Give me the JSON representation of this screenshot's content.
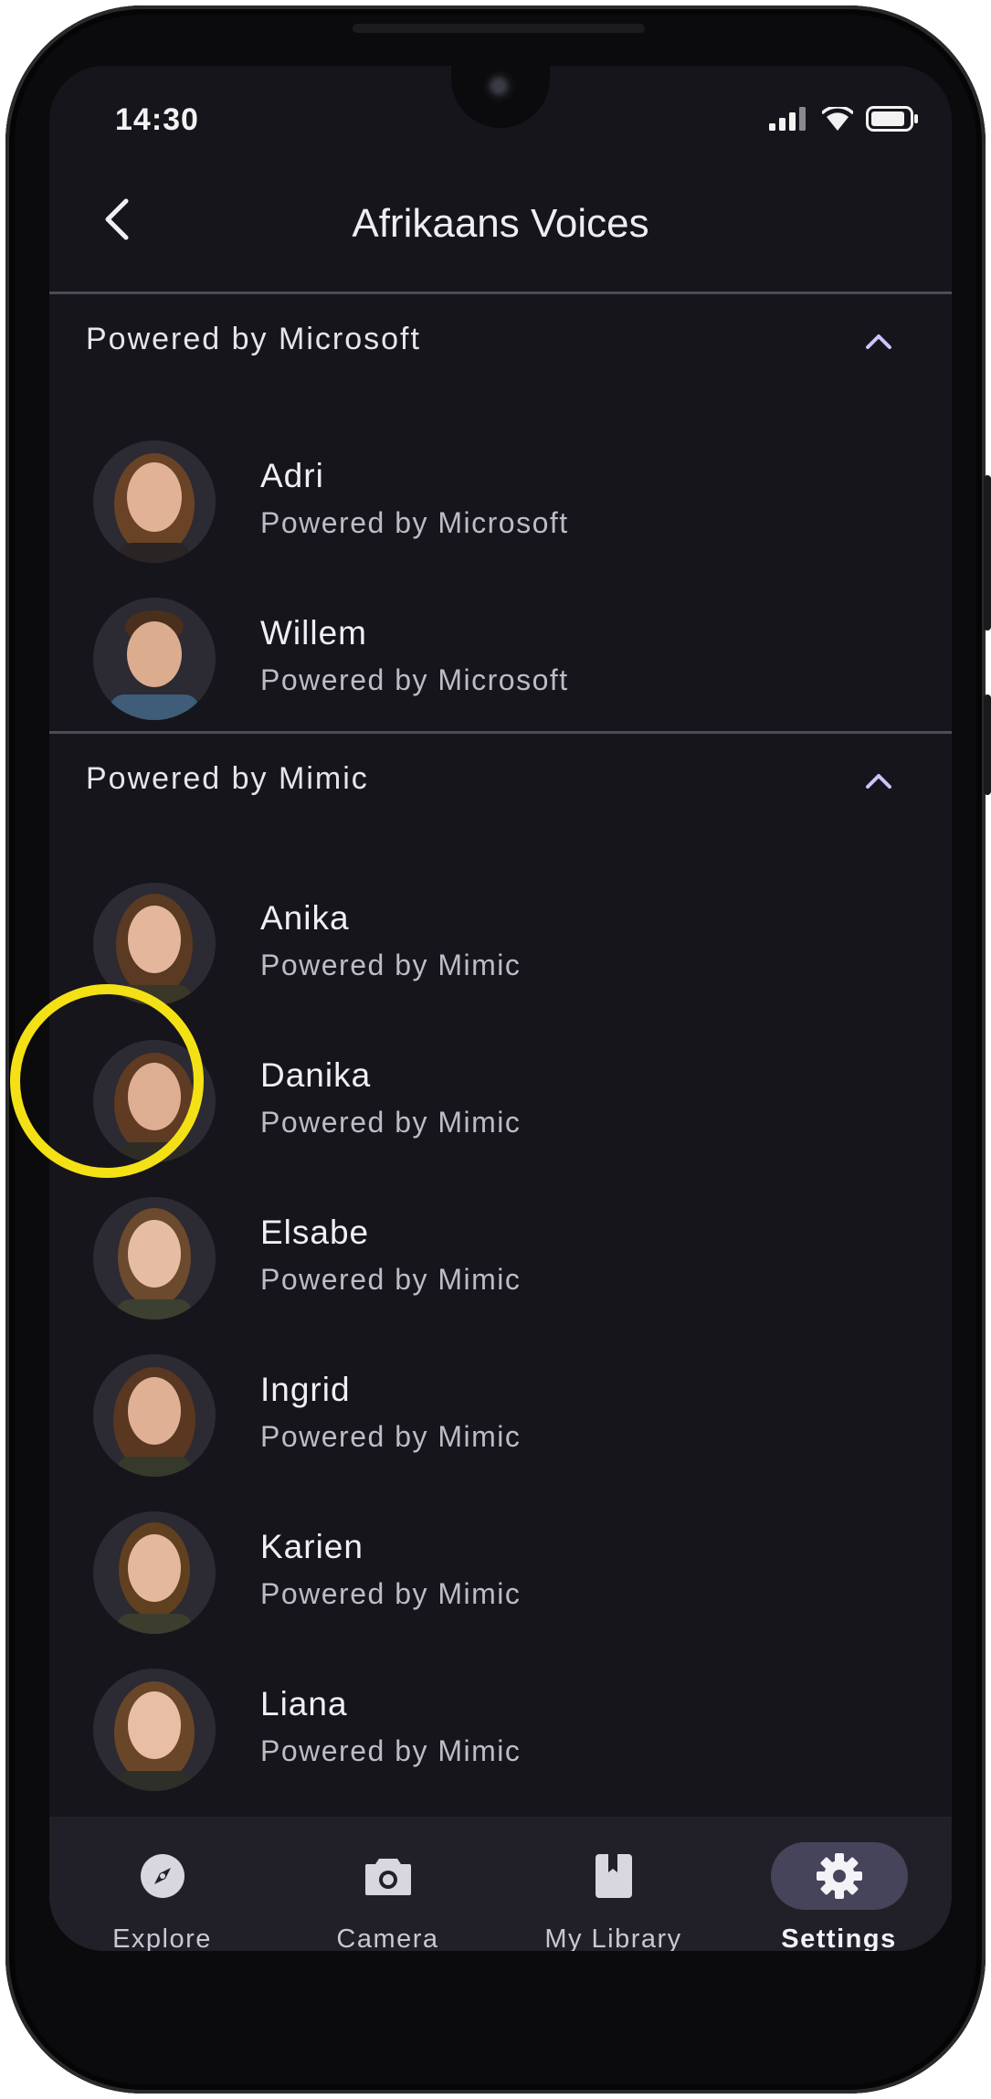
{
  "status_bar": {
    "time": "14:30"
  },
  "app_bar": {
    "title": "Afrikaans Voices"
  },
  "sections": [
    {
      "title": "Powered by Microsoft",
      "voices": [
        {
          "name": "Adri",
          "provider": "Powered by Microsoft"
        },
        {
          "name": "Willem",
          "provider": "Powered by Microsoft"
        }
      ]
    },
    {
      "title": "Powered by Mimic",
      "voices": [
        {
          "name": "Anika",
          "provider": "Powered by Mimic"
        },
        {
          "name": "Danika",
          "provider": "Powered by Mimic"
        },
        {
          "name": "Elsabe",
          "provider": "Powered by Mimic"
        },
        {
          "name": "Ingrid",
          "provider": "Powered by Mimic"
        },
        {
          "name": "Karien",
          "provider": "Powered by Mimic"
        },
        {
          "name": "Liana",
          "provider": "Powered by Mimic"
        }
      ]
    }
  ],
  "bottom_nav": [
    {
      "label": "Explore",
      "icon": "compass-icon"
    },
    {
      "label": "Camera",
      "icon": "camera-icon"
    },
    {
      "label": "My Library",
      "icon": "book-icon"
    },
    {
      "label": "Settings",
      "icon": "gear-icon",
      "active": true
    }
  ],
  "colors": {
    "background": "#16151b",
    "nav_background": "#211f28",
    "active_pill": "#46445a",
    "highlight_ring": "#f4e115",
    "accent": "#cfc3ff"
  }
}
